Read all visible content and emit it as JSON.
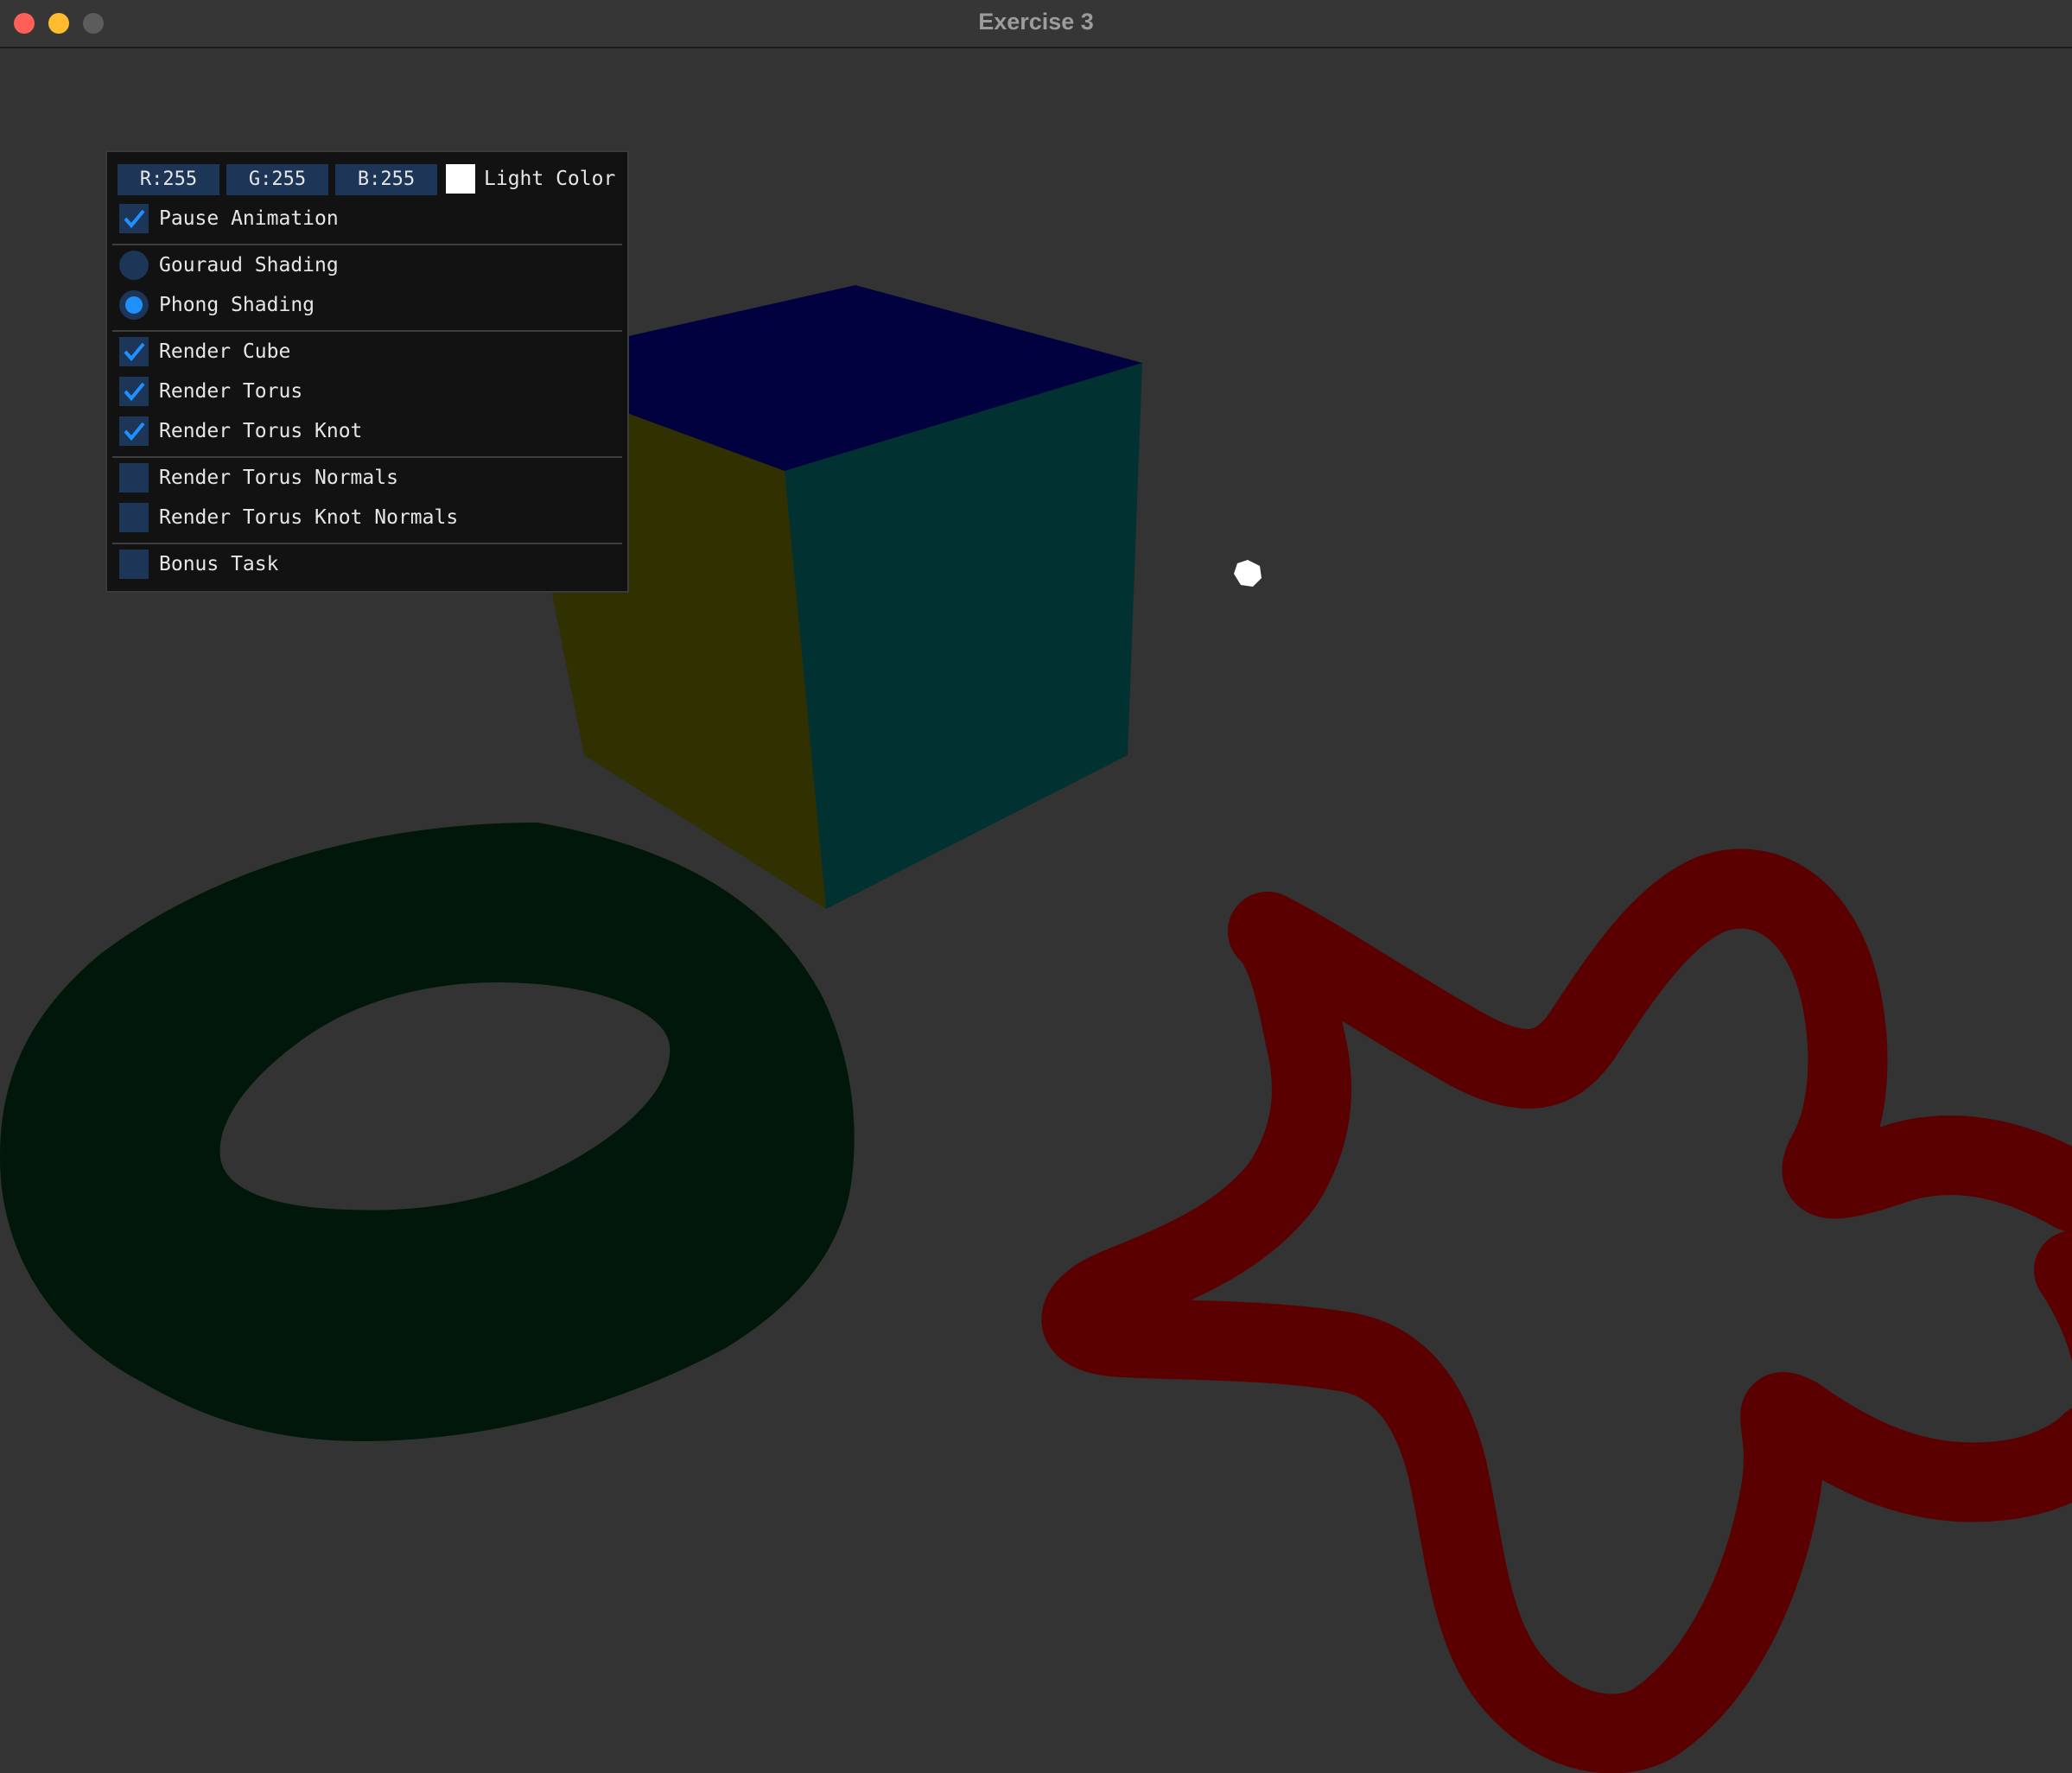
{
  "window": {
    "title": "Exercise 3"
  },
  "panel": {
    "rgb": {
      "r_label": "R:255",
      "g_label": "G:255",
      "b_label": "B:255"
    },
    "light_color_label": "Light Color",
    "light_color_value": "#ffffff",
    "pause_animation": {
      "label": "Pause Animation",
      "checked": true
    },
    "shading": {
      "gouraud_label": "Gouraud Shading",
      "phong_label": "Phong Shading",
      "selected": "phong"
    },
    "render_cube": {
      "label": "Render Cube",
      "checked": true
    },
    "render_torus": {
      "label": "Render Torus",
      "checked": true
    },
    "render_torus_knot": {
      "label": "Render Torus Knot",
      "checked": true
    },
    "render_torus_normals": {
      "label": "Render Torus Normals",
      "checked": false
    },
    "render_torus_knot_normals": {
      "label": "Render Torus Knot Normals",
      "checked": false
    },
    "bonus_task": {
      "label": "Bonus Task",
      "checked": false
    }
  },
  "colors": {
    "background": "#333333",
    "cube_top": "#010140",
    "cube_left": "#303000",
    "cube_right": "#013131",
    "torus": "#001709",
    "torus_knot": "#5a0000",
    "light_marker": "#ffffff",
    "accent": "#1e90ff",
    "widget_bg": "#1d3556"
  }
}
